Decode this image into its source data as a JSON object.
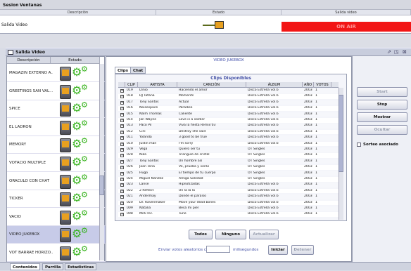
{
  "menu": {
    "items": [
      "Sesion",
      "Ventanas"
    ]
  },
  "top_table": {
    "headers": {
      "description": "Descripción",
      "status": "Estado",
      "output": "Salida video"
    },
    "row": {
      "description": "Salida Video",
      "status_button": "ON AIR"
    }
  },
  "window": {
    "title": "Salida Video",
    "controls": [
      "restore-icon",
      "maximize-icon",
      "close-icon"
    ]
  },
  "left_panel": {
    "headers": {
      "description": "Descripción",
      "status": "Estado"
    },
    "items": [
      {
        "name": "MAGAZIN EXTERNO A...",
        "selected": false
      },
      {
        "name": "GREETINGS SAN VAL...",
        "selected": false
      },
      {
        "name": "SPICE",
        "selected": false
      },
      {
        "name": "EL LADRÓN",
        "selected": false
      },
      {
        "name": "MEMORY",
        "selected": false
      },
      {
        "name": "VOTACIÓ MÚLTIPLE",
        "selected": false
      },
      {
        "name": "ORACULO CON CHAT",
        "selected": false
      },
      {
        "name": "TICKER",
        "selected": false
      },
      {
        "name": "VACIO",
        "selected": false
      },
      {
        "name": "VIDEO JUKEBOX",
        "selected": true
      },
      {
        "name": "VOT BARRAE HORIZO...",
        "selected": false
      }
    ]
  },
  "center": {
    "title": "VIDEO JUKEBOX",
    "tabs": [
      "Clips",
      "Chat"
    ],
    "catalog_title": "Clips Disponibles",
    "columns": [
      "",
      "CLIP",
      "ARTISTA",
      "CANCIÓN",
      "ÁLBUM",
      "AÑO",
      "VOTOS"
    ],
    "rows": [
      [
        "",
        "019",
        "Dinio",
        "Haciendo el amor",
        "Disco Estrella vol.6",
        "2003",
        "1"
      ],
      [
        "",
        "018",
        "DJ Tatana",
        "Moments",
        "Disco Estrella vol.6",
        "2003",
        "1"
      ],
      [
        "",
        "017",
        "Tony Santos",
        "Actual",
        "Disco Estrella vol.6",
        "2003",
        "1"
      ],
      [
        "",
        "016",
        "Noisespace",
        "Paradise",
        "Disco Estrella vol.6",
        "2003",
        "1"
      ],
      [
        "",
        "015",
        "Nalm Thomas",
        "Caliente",
        "Disco Estrella vol.6",
        "2003",
        "1"
      ],
      [
        "",
        "014",
        "Jan Wayne",
        "Love is a soldier",
        "Disco Estrella vol.6",
        "2003",
        "1"
      ],
      [
        "",
        "013",
        "Paco Pil",
        "Viva la fiesta Remix'03",
        "Disco Estrella vol.6",
        "2003",
        "1"
      ],
      [
        "",
        "012",
        "Circ",
        "Destroy she said",
        "Disco Estrella vol.6",
        "2003",
        "1"
      ],
      [
        "",
        "011",
        "Yolanda",
        "3 good to be true",
        "Disco Estrella vol.6",
        "2003",
        "1"
      ],
      [
        "",
        "010",
        "Justin man",
        "I'm sorry",
        "Disco Estrella vol.6",
        "2003",
        "1"
      ],
      [
        "",
        "029",
        "Vega",
        "Quiero ser tu",
        "OT Singles",
        "2003",
        "1"
      ],
      [
        "",
        "028",
        "Nika",
        "Triangulo de cristal",
        "OT Singles",
        "2003",
        "1"
      ],
      [
        "",
        "027",
        "Tony Santos",
        "Un hombre así",
        "OT Singles",
        "2003",
        "1"
      ],
      [
        "",
        "026",
        "Joan Tena",
        "Ve, prueba y verás",
        "OT Singles",
        "2003",
        "1"
      ],
      [
        "",
        "025",
        "Hugo",
        "El tiempo de tu cuerpo",
        "OT Singles",
        "2003",
        "1"
      ],
      [
        "",
        "024",
        "Miguel Nandez",
        "Amiga Soledad",
        "OT Singles",
        "2003",
        "1"
      ],
      [
        "",
        "023",
        "Lanse",
        "Hipnotizadas",
        "Disco Estrella vol.6",
        "2003",
        "1"
      ],
      [
        "",
        "022",
        "2 Reflect",
        "Un la la la",
        "Disco Estrella vol.6",
        "2003",
        "1"
      ],
      [
        "",
        "021",
        "Andermay",
        "Donde el paraíso",
        "Disco Estrella vol.6",
        "2003",
        "1"
      ],
      [
        "",
        "020",
        "Dr. Ravenmaker",
        "Move your dead bones",
        "Disco Estrella vol.6",
        "2003",
        "1"
      ],
      [
        "",
        "009",
        "Natalia",
        "Besa mi piel",
        "Disco Estrella vol.6",
        "2003",
        "1"
      ],
      [
        "",
        "008",
        "Mirk Inc.",
        "Tune",
        "Disco Estrella vol.6",
        "2003",
        "1"
      ]
    ],
    "buttons": {
      "all": "Todos",
      "none": "Ninguno",
      "refresh": "Actualizar"
    },
    "send_label_before": "Enviar votos aleatorios cada",
    "send_label_after": "milisegundos",
    "start": "Iniciar",
    "stop": "Detener"
  },
  "right_panel": {
    "buttons": {
      "start": "Start",
      "stop": "Stop",
      "show": "Mostrar",
      "hide": "Ocultar"
    },
    "checkbox": "Sorteo asociado"
  },
  "bottom_tabs": [
    "Contenidos",
    "Parrilla",
    "Estadísticas"
  ],
  "colors": {
    "onair": "#f21515",
    "accent": "#3c4aa8",
    "tv_screen": "#e8a020",
    "gear": "#35b21b"
  }
}
